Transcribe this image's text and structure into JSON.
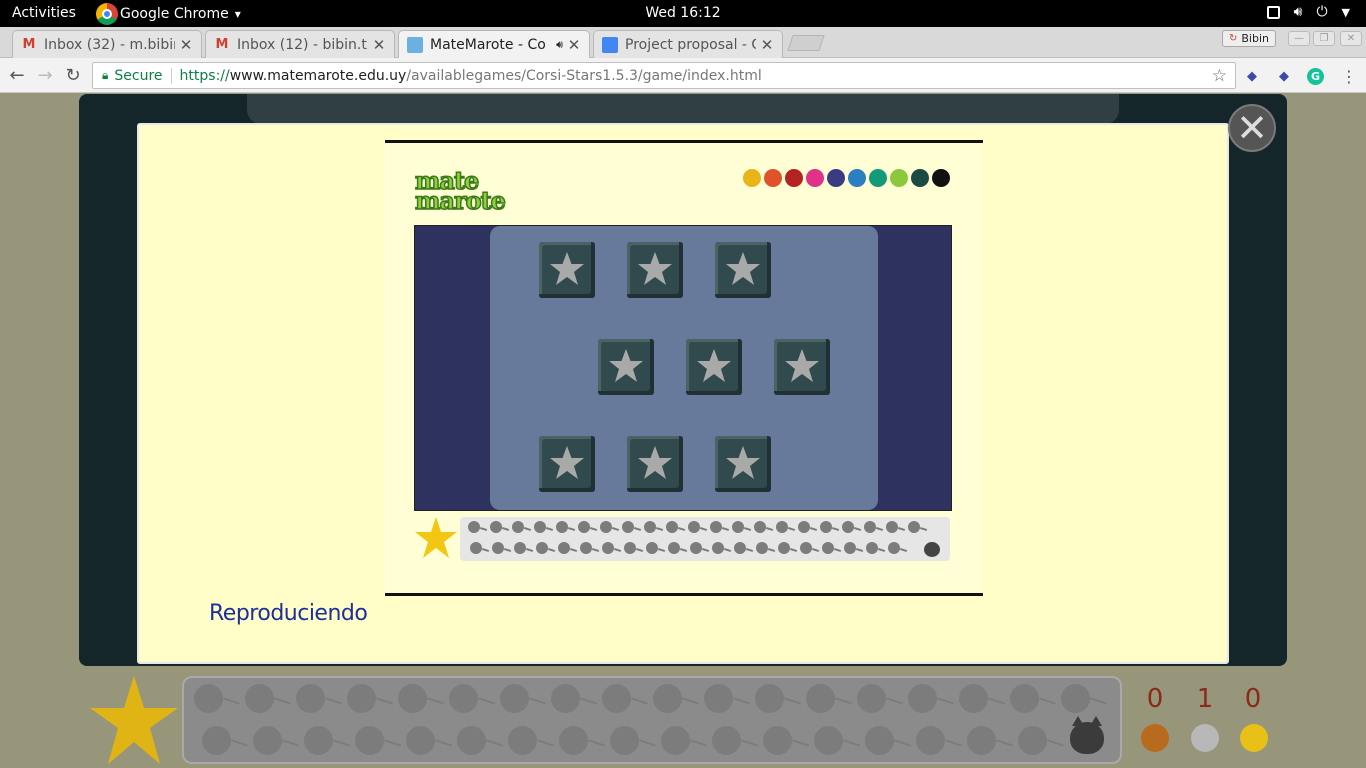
{
  "topbar": {
    "activities": "Activities",
    "app_name": "Google Chrome",
    "app_menu_arrow": "▾",
    "clock": "Wed 16:12"
  },
  "tabs": [
    {
      "title": "Inbox (32) - m.bibin",
      "icon": "gmail-icon"
    },
    {
      "title": "Inbox (12) - bibin.th",
      "icon": "gmail-icon"
    },
    {
      "title": "MateMarote - Co",
      "icon": "matemarote-icon",
      "audio": true
    },
    {
      "title": "Project proposal - G",
      "icon": "docs-icon"
    }
  ],
  "profile": {
    "name": "Bibin"
  },
  "address": {
    "secure_label": "Secure",
    "scheme": "https://",
    "host": "www.matemarote.edu.uy",
    "path": "/availablegames/Corsi-Stars1.5.3/game/index.html"
  },
  "video": {
    "logo_line1": "mate",
    "logo_line2": "marote",
    "color_dots": [
      "#e8b418",
      "#e0522a",
      "#b52222",
      "#e0328a",
      "#3a3c82",
      "#2a7fc0",
      "#149a7a",
      "#8cc83c",
      "#1a4a44",
      "#111111"
    ]
  },
  "status_text": "Reproduciendo",
  "scores": [
    "0",
    "1",
    "0"
  ],
  "medal_colors": [
    "#b86a1e",
    "#b8b8b8",
    "#e8c018"
  ],
  "colors": {
    "modal_bg": "#fffec9",
    "status_text": "#1c2f9a",
    "score_text": "#8a2b1a"
  }
}
